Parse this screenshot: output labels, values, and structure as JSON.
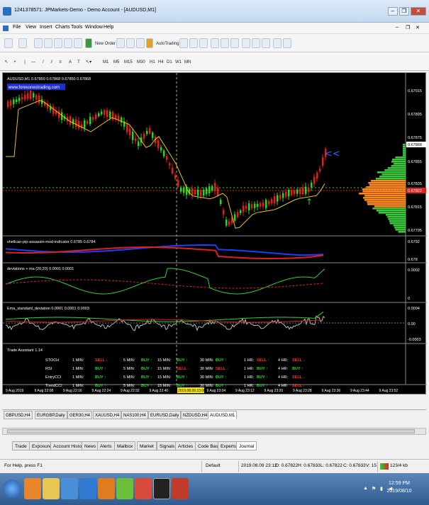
{
  "window": {
    "title": "1241378571: JPMarkets-Demo - Demo Account - [AUDUSD,M1]",
    "minimize": "–",
    "restore": "❐",
    "close": "✕"
  },
  "menu": [
    "File",
    "View",
    "Insert",
    "Charts",
    "Tools",
    "Window",
    "Help"
  ],
  "toolbar": {
    "new_order": "New Order",
    "auto_trading": "AutoTrading",
    "timeframes": [
      "M1",
      "M5",
      "M15",
      "M30",
      "H1",
      "H4",
      "D1",
      "W1",
      "MN"
    ]
  },
  "chart": {
    "main_label": "AUDUSD,M1  0.67850 0.67868 0.67850 0.67868",
    "watermark": "www.forexonestrading.com",
    "price_ticks": [
      "0.67915",
      "0.67895",
      "0.67875",
      "0.67868",
      "0.67855",
      "0.67835",
      "0.67822",
      "0.67815",
      "0.67795"
    ],
    "current_price": "0.67822",
    "panel1_label": "shellcan-pip-assassin-mod-indicator 0.6785 0.6784",
    "panel1_ticks": [
      "0.6792",
      "0.678"
    ],
    "panel2_label": "deviations + ma (20,20) 0.0001 0.0001",
    "panel2_ticks": [
      "0.0002",
      "0"
    ],
    "panel3_label": "Ema_standard_deviation 0.0001 0.0001 0.0003",
    "panel3_ticks": [
      "0.0004",
      "0.00",
      "-0.0003"
    ],
    "time_ticks": [
      "9 Aug 2019",
      "9 Aug 22:08",
      "9 Aug 22:16",
      "9 Aug 22:24",
      "9 Aug 22:32",
      "9 Aug 22:40",
      "2019.08.09 23:00",
      "9 Aug 23:04",
      "9 Aug 23:12",
      "9 Aug 23:20",
      "9 Aug 23:28",
      "9 Aug 23:36",
      "9 Aug 23:44",
      "9 Aug 23:52"
    ]
  },
  "trade_assistant": {
    "title": "Trade Assistant 1.14",
    "rows": [
      {
        "name": "STOCH",
        "signals": [
          [
            "1 MIN:",
            "SELL"
          ],
          [
            "5 MIN:",
            "BUY"
          ],
          [
            "15 MIN:",
            "BUY"
          ],
          [
            "30 MIN:",
            "BUY"
          ],
          [
            "1 HR:",
            "SELL"
          ],
          [
            "4 HR:",
            "SELL"
          ]
        ]
      },
      {
        "name": "RSI",
        "signals": [
          [
            "1 MIN:",
            "BUY"
          ],
          [
            "5 MIN:",
            "BUY"
          ],
          [
            "15 MIN:",
            "SELL"
          ],
          [
            "30 MIN:",
            "SELL"
          ],
          [
            "1 HR:",
            "BUY"
          ],
          [
            "4 HR:",
            "BUY"
          ]
        ]
      },
      {
        "name": "EntryCCI",
        "signals": [
          [
            "1 MIN:",
            "BUY"
          ],
          [
            "5 MIN:",
            "BUY"
          ],
          [
            "15 MIN:",
            "BUY"
          ],
          [
            "30 MIN:",
            "BUY"
          ],
          [
            "1 HR:",
            "BUY"
          ],
          [
            "4 HR:",
            "SELL"
          ]
        ]
      },
      {
        "name": "TrendCCI",
        "signals": [
          [
            "1 MIN:",
            "BUY"
          ],
          [
            "5 MIN:",
            "BUY"
          ],
          [
            "15 MIN:",
            "BUY"
          ],
          [
            "30 MIN:",
            "BUY"
          ],
          [
            "1 HR:",
            "BUY"
          ],
          [
            "4 HR:",
            "SELL"
          ]
        ]
      }
    ]
  },
  "chart_tabs": [
    "GBPUSD,H4",
    "EURGBP,Daily",
    "GER30,H4",
    "XAUUSD,H4",
    "NAS100,H4",
    "EURUSD,Daily",
    "NZDUSD,H4",
    "AUDUSD,M1"
  ],
  "terminal_tabs": [
    "Trade",
    "Exposure",
    "Account History",
    "News",
    "Alerts",
    "Mailbox",
    "Market",
    "Signals",
    "Articles",
    "Code Base",
    "Experts",
    "Journal"
  ],
  "status": {
    "help": "For Help, press F1",
    "profile": "Default",
    "datetime": "2019.08.09 23:12",
    "open": "O: 0.67822",
    "high": "H: 0.67833",
    "low": "L: 0.67822",
    "close": "C: 0.67833",
    "volume": "V: 15",
    "traffic": "123/4 kb"
  },
  "taskbar": {
    "time": "12:59 PM",
    "date": "2019/08/10"
  },
  "colors": {
    "bull": "#2bd62b",
    "bear": "#e02020",
    "ma": "#e8c020",
    "buy_text": "#22dd22",
    "sell_text": "#ff2a2a"
  }
}
